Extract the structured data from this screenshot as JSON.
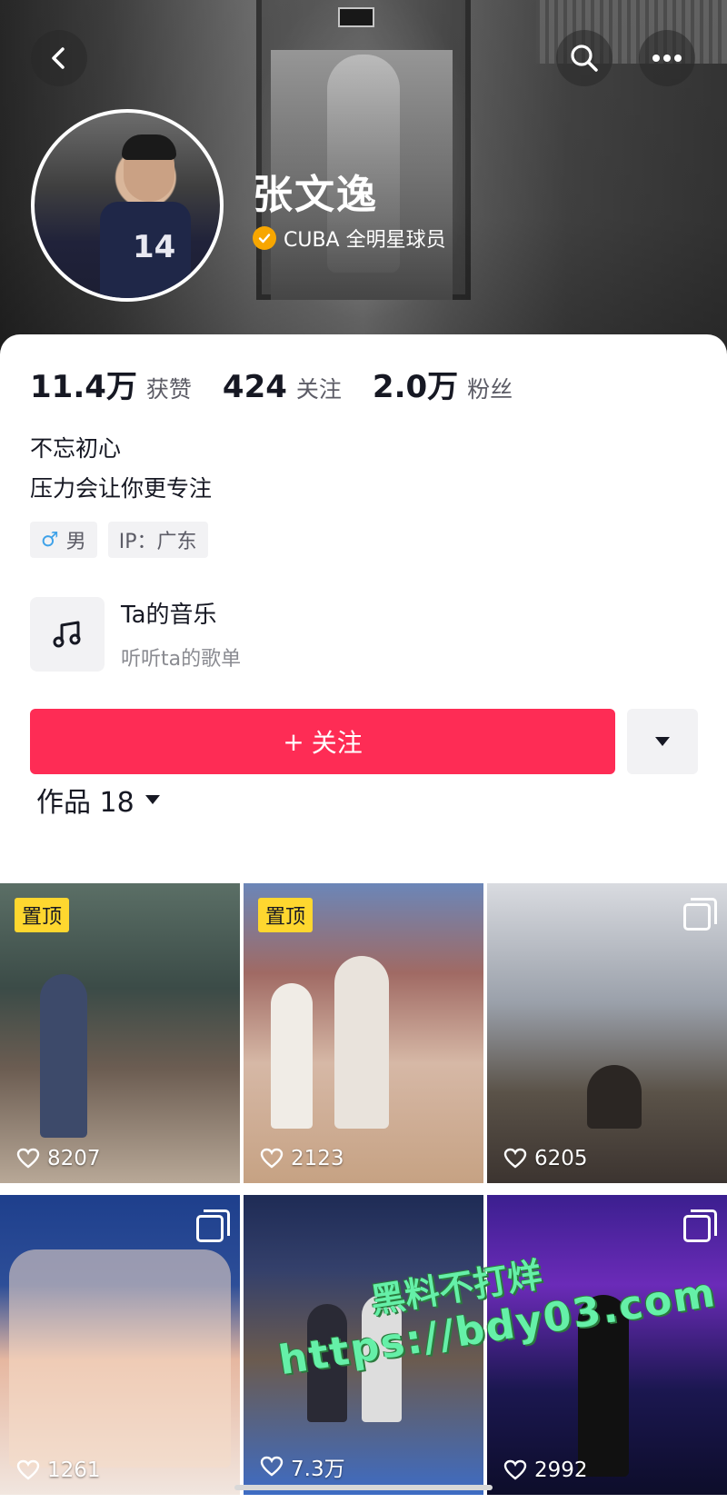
{
  "header": {
    "name": "张文逸",
    "verify_text": "CUBA 全明星球员",
    "back_icon": "chevron-left-icon",
    "search_icon": "search-icon",
    "more_icon": "more-dots-icon"
  },
  "stats": [
    {
      "value": "11.4万",
      "label": "获赞"
    },
    {
      "value": "424",
      "label": "关注"
    },
    {
      "value": "2.0万",
      "label": "粉丝"
    }
  ],
  "bio": {
    "line1": "不忘初心",
    "line2": "压力会让你更专注"
  },
  "tags": {
    "gender_symbol": "♂",
    "gender": "男",
    "ip": "IP：广东"
  },
  "music": {
    "title": "Ta的音乐",
    "subtitle": "听听ta的歌单"
  },
  "follow": {
    "plus": "+",
    "label": "关注"
  },
  "works": {
    "label": "作品 18"
  },
  "grid": [
    {
      "likes": "8207",
      "pinned": true,
      "pin_label": "置顶"
    },
    {
      "likes": "2123",
      "pinned": true,
      "pin_label": "置顶"
    },
    {
      "likes": "6205",
      "multi": true
    },
    {
      "likes": "1261",
      "multi": true
    },
    {
      "likes": "7.3万"
    },
    {
      "likes": "2992",
      "multi": true
    }
  ],
  "watermark": {
    "line1": "黑料不打烊",
    "line2": "https://bdy03.com"
  },
  "colors": {
    "accent": "#fe2c55",
    "pin": "#fed72f",
    "verify": "#f7a600",
    "gender": "#3fa2e9"
  }
}
